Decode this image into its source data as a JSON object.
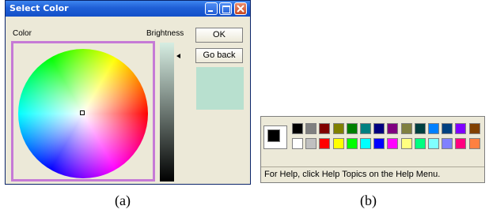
{
  "dialog": {
    "title": "Select Color",
    "color_label": "Color",
    "brightness_label": "Brightness",
    "ok_label": "OK",
    "goback_label": "Go back",
    "preview_color": "#b8e0cf"
  },
  "palette": {
    "status_text": "For Help, click Help Topics on the Help Menu.",
    "foreground": "#000000",
    "background": "#ffffff",
    "row1": [
      "#000000",
      "#808080",
      "#800000",
      "#808000",
      "#008000",
      "#008080",
      "#000080",
      "#800080",
      "#808040",
      "#004040",
      "#0080ff",
      "#004080",
      "#8000ff",
      "#804000"
    ],
    "row2": [
      "#ffffff",
      "#c0c0c0",
      "#ff0000",
      "#ffff00",
      "#00ff00",
      "#00ffff",
      "#0000ff",
      "#ff00ff",
      "#ffff80",
      "#00ff80",
      "#80ffff",
      "#8080ff",
      "#ff0080",
      "#ff8040"
    ]
  },
  "captions": {
    "a": "(a)",
    "b": "(b)"
  }
}
